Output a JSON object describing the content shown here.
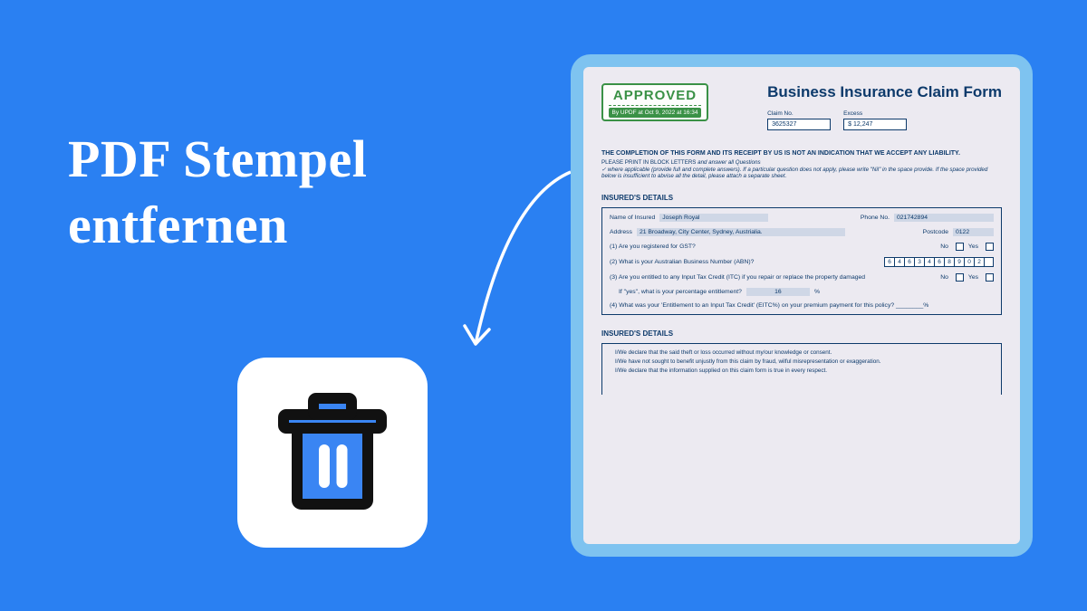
{
  "headline": {
    "line1": "PDF Stempel",
    "line2": "entfernen"
  },
  "stamp": {
    "title": "APPROVED",
    "byline": "By UPDF at Oct 9, 2022 at 16:34"
  },
  "doc": {
    "title": "Business Insurance Claim Form",
    "claim_no_label": "Claim No.",
    "claim_no_value": "3625327",
    "excess_label": "Excess",
    "excess_value": "$ 12,247",
    "notice": "THE COMPLETION OF THIS FORM AND ITS RECEIPT BY US IS NOT AN INDICATION THAT WE ACCEPT ANY LIABILITY.",
    "sub1_a": "PLEASE PRINT IN BLOCK LETTERS ",
    "sub1_b": "and answer all Questions",
    "sub2": "✓ where applicable (provide full and complete answers). If a particular question does not apply, please write \"Nil\" in the space provide. If the space provided below is insufficient to abvise all the detail, please attach a separate sheet.",
    "section1": "INSURED'S DETAILS",
    "name_label": "Name of Insured",
    "name_value": "Joseph Royal",
    "phone_label": "Phone No.",
    "phone_value": "021742894",
    "address_label": "Address",
    "address_value": "21 Broadway, City Center, Sydney, Austrialia.",
    "postcode_label": "Postcode",
    "postcode_value": "0122",
    "q1": "(1) Are you registered for GST?",
    "q2": "(2) What is your Australian Business Number (ABN)?",
    "abn": [
      "6",
      "4",
      "6",
      "3",
      "4",
      "6",
      "8",
      "9",
      "0",
      "2",
      ""
    ],
    "q3a": "(3) Are you entitled to any Input Tax Credit (ITC) if you repair or replace the property damaged",
    "q3b": "If \"yes\", what is your percentage entitlement?",
    "q3_pct": "16",
    "q4": "(4) What was your 'Entitlement to an Input Tax Credit' (EITC%) on your premium payment for this policy? ________%",
    "no": "No",
    "yes": "Yes",
    "pct": "%",
    "section2": "INSURED'S DETAILS",
    "decl1": "I/We declare that the said theft or loss occurred without my/our knowledge or consent.",
    "decl2": "I/We have not sought to benefit unjustly from this claim by fraud, wilful misrepresentation or exaggeration.",
    "decl3": "I/We declare that the information supplied on this claim form is true in every respect."
  }
}
